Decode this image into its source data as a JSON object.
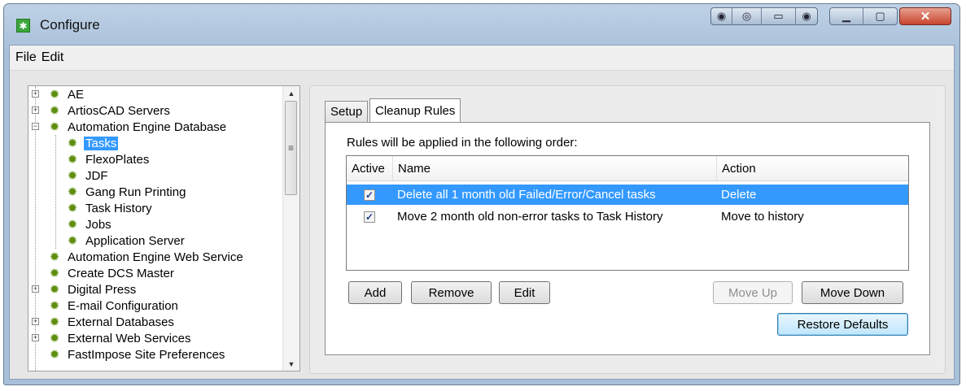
{
  "window": {
    "title": "Configure"
  },
  "menu": [
    "File",
    "Edit"
  ],
  "tree": [
    {
      "label": "AE",
      "icon": "gear-icon"
    },
    {
      "label": "ArtiosCAD Servers",
      "icon": "gear-icon"
    },
    {
      "label": "Automation Engine Database",
      "icon": "gear-icon"
    },
    {
      "label": "Tasks",
      "icon": "gear-icon"
    },
    {
      "label": "FlexoPlates",
      "icon": "gear-icon"
    },
    {
      "label": "JDF",
      "icon": "gear-icon"
    },
    {
      "label": "Gang Run Printing",
      "icon": "gear-icon"
    },
    {
      "label": "Task History",
      "icon": "gear-icon"
    },
    {
      "label": "Jobs",
      "icon": "gear-icon"
    },
    {
      "label": "Application Server",
      "icon": "gear-icon"
    },
    {
      "label": "Automation Engine Web Service",
      "icon": "gear-icon"
    },
    {
      "label": "Create DCS Master",
      "icon": "gear-icon"
    },
    {
      "label": "Digital Press",
      "icon": "gear-icon"
    },
    {
      "label": "E-mail Configuration",
      "icon": "gear-icon"
    },
    {
      "label": "External Databases",
      "icon": "gear-icon"
    },
    {
      "label": "External Web Services",
      "icon": "gear-icon"
    },
    {
      "label": "FastImpose Site Preferences",
      "icon": "gear-icon"
    }
  ],
  "tabs": [
    "Setup",
    "Cleanup Rules"
  ],
  "cleanup": {
    "intro": "Rules will be applied in the following order:",
    "columns": [
      "Active",
      "Name",
      "Action"
    ],
    "rows": [
      {
        "active": true,
        "name": "Delete all 1 month old Failed/Error/Cancel tasks",
        "action": "Delete"
      },
      {
        "active": true,
        "name": "Move 2 month old non-error tasks  to Task History",
        "action": "Move to history"
      }
    ]
  },
  "buttons": {
    "add": "Add",
    "remove": "Remove",
    "edit": "Edit",
    "move_up": "Move Up",
    "move_down": "Move Down",
    "restore_defaults": "Restore Defaults"
  },
  "colors": {
    "selection": "#3399ff",
    "node_icon": "#5e8e0e",
    "close_button": "#c8452f"
  }
}
